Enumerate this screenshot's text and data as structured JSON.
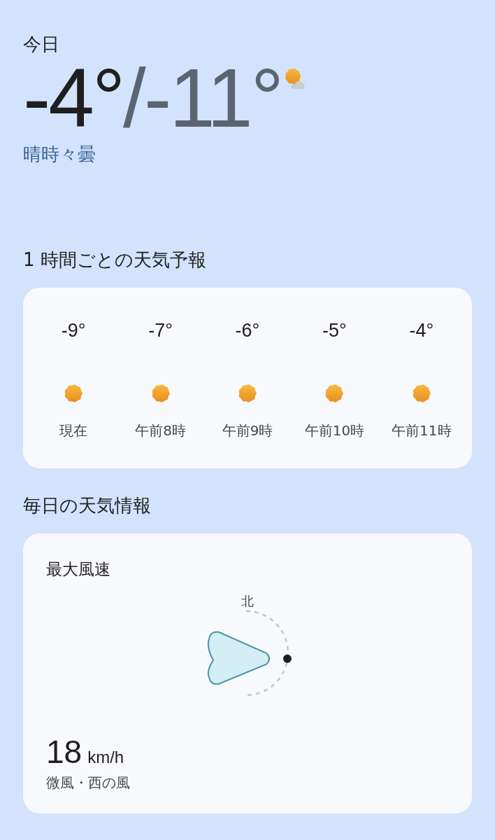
{
  "today": {
    "label": "今日",
    "high": "-4°",
    "low": "/-11°",
    "kind": "partly_cloudy",
    "condition": "晴時々曇"
  },
  "hourly": {
    "title": "1 時間ごとの天気予報",
    "items": [
      {
        "temp": "-9°",
        "kind": "sunny",
        "time": "現在"
      },
      {
        "temp": "-7°",
        "kind": "sunny",
        "time": "午前8時"
      },
      {
        "temp": "-6°",
        "kind": "sunny",
        "time": "午前9時"
      },
      {
        "temp": "-5°",
        "kind": "sunny",
        "time": "午前10時"
      },
      {
        "temp": "-4°",
        "kind": "sunny",
        "time": "午前11時"
      }
    ]
  },
  "daily": {
    "title": "毎日の天気情報",
    "wind": {
      "title": "最大風速",
      "compass_label": "北",
      "speed": "18",
      "unit": "km/h",
      "description": "微風・西の風"
    }
  }
}
